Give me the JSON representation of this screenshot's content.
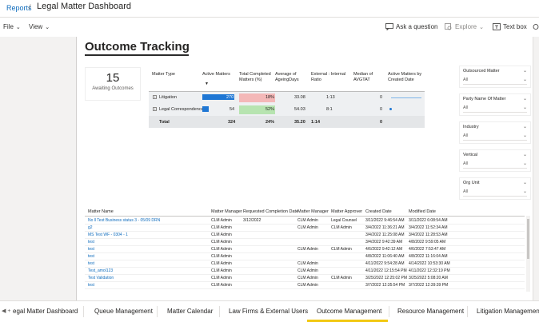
{
  "breadcrumb": {
    "link": "Reports",
    "separator": "/",
    "title": "Legal Matter Dashboard"
  },
  "toolbar": {
    "file": "File",
    "view": "View",
    "ask": "Ask a question",
    "explore": "Explore",
    "textbox": "Text box"
  },
  "report": {
    "title": "Outcome Tracking",
    "kpi": {
      "value": "15",
      "label": "Awaiting Outcomes"
    },
    "matrix": {
      "headers": {
        "matter_type": "Matter Type",
        "active": "Active Matters",
        "completed": "Total Completed Matters (%)",
        "ageing": "Average of AgeingDays",
        "ratio": "External : Internal Ratio",
        "avgtat": "Median of AVGTAT",
        "active_by_date": "Active Matters by Created Date"
      },
      "rows": [
        {
          "type": "Litigation",
          "active": "270",
          "completed": "18%",
          "ageing": "33.08",
          "ratio": "1:13",
          "avgtat": "0",
          "active_fraction": 0.83
        },
        {
          "type": "Legal Correspondence",
          "active": "54",
          "completed": "52%",
          "ageing": "54.03",
          "ratio": "8:1",
          "avgtat": "0",
          "active_fraction": 0.17
        }
      ],
      "total": {
        "label": "Total",
        "active": "324",
        "completed": "24%",
        "ageing": "35.20",
        "ratio": "1:14",
        "avgtat": "0"
      }
    },
    "slicers": [
      {
        "title": "Outsourced Matter",
        "value": "All"
      },
      {
        "title": "Party Name Of Matter",
        "value": "All"
      },
      {
        "title": "Industry",
        "value": "All"
      },
      {
        "title": "Vertical",
        "value": "All"
      },
      {
        "title": "Org Unit",
        "value": "All"
      }
    ],
    "table": {
      "columns": [
        "Matter Name",
        "Matter Manager",
        "Requested Completion Date",
        "Matter Manager",
        "Matter Approver",
        "Created Date",
        "Modified Date"
      ],
      "rows": [
        [
          "No ll Test Business status 3 - 05/09 DRN",
          "CLM Admin",
          "3/12/2022",
          "CLM Admin",
          "Legal Counsel",
          "3/11/2022 9:46:54 AM",
          "3/11/2022 6:08:54 AM"
        ],
        [
          "g2",
          "CLM Admin",
          "",
          "CLM Admin",
          "CLM Admin",
          "3/4/2022 11:36:21 AM",
          "3/4/2022 11:52:34 AM"
        ],
        [
          "MS Test WF - 0304 - 1",
          "CLM Admin",
          "",
          "",
          "",
          "3/4/2022 11:25:08 AM",
          "3/4/2022 11:28:53 AM"
        ],
        [
          "test",
          "CLM Admin",
          "",
          "",
          "",
          "3/4/2022 9:42:39 AM",
          "4/8/2022 9:59:05 AM"
        ],
        [
          "test",
          "CLM Admin",
          "",
          "CLM Admin",
          "CLM Admin",
          "4/6/2022 9:42:12 AM",
          "4/6/2022 7:53:47 AM"
        ],
        [
          "test",
          "CLM Admin",
          "",
          "",
          "",
          "4/8/2022 11:06:40 AM",
          "4/8/2022 11:16:04 AM"
        ],
        [
          "test",
          "CLM Admin",
          "",
          "CLM Admin",
          "",
          "4/11/2022 9:54:28 AM",
          "4/14/2022 10:53:30 AM"
        ],
        [
          "Test_amol123",
          "CLM Admin",
          "",
          "CLM Admin",
          "",
          "4/11/2022 12:15:54 PM",
          "4/11/2022 12:32:19 PM"
        ],
        [
          "Test Validation",
          "CLM Admin",
          "",
          "CLM Admin",
          "CLM Admin",
          "3/25/2022 12:25:02 PM",
          "3/25/2022 5:08:20 AM"
        ],
        [
          "test",
          "CLM Admin",
          "",
          "CLM Admin",
          "",
          "3/7/2022 12:35:54 PM",
          "3/7/2022 12:39:39 PM"
        ]
      ]
    }
  },
  "tabs": {
    "items": [
      "egal Matter Dashboard",
      "Queue Management",
      "Matter Calendar",
      "Law Firms & External Users",
      "Outcome Management",
      "Resource Management",
      "Litigation Management"
    ],
    "active_index": 4
  }
}
